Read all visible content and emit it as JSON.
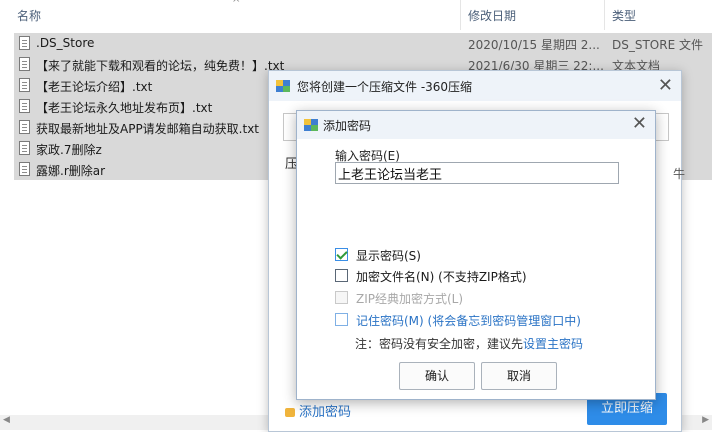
{
  "explorer": {
    "columns": {
      "name": "名称",
      "date": "修改日期",
      "type": "类型"
    },
    "files": [
      {
        "name": ".DS_Store",
        "date": "2020/10/15 星期四 2...",
        "type": "DS_STORE 文件"
      },
      {
        "name": "【来了就能下载和观看的论坛，纯免费！】.txt",
        "date": "2021/6/30 星期三 22:...",
        "type": "文本文档"
      },
      {
        "name": "【老王论坛介绍】.txt",
        "date": "",
        "type": ""
      },
      {
        "name": "【老王论坛永久地址发布页】.txt",
        "date": "",
        "type": ""
      },
      {
        "name": "获取最新地址及APP请发邮箱自动获取.txt",
        "date": "",
        "type": ""
      },
      {
        "name": "家政.7删除z",
        "date": "",
        "type": ""
      },
      {
        "name": "露娜.r删除ar",
        "date": "",
        "type": ""
      }
    ]
  },
  "compress_dialog": {
    "title": "您将创建一个压缩文件 -360压缩",
    "label_partial": "压",
    "tail_text": "牛",
    "add_password_link": "添加密码",
    "compress_button": "立即压缩"
  },
  "password_dialog": {
    "title": "添加密码",
    "password_label": "输入密码(E)",
    "password_value": "上老王论坛当老王",
    "options": {
      "show_password": "显示密码(S)",
      "encrypt_filenames": "加密文件名(N) (不支持ZIP格式)",
      "zip_classic": "ZIP经典加密方式(L)",
      "remember_password": "记住密码(M) (将会备忘到密码管理窗口中)"
    },
    "note_prefix": "注：密码没有安全加密，建议先",
    "note_link": "设置主密码",
    "ok_button": "确认",
    "cancel_button": "取消"
  }
}
